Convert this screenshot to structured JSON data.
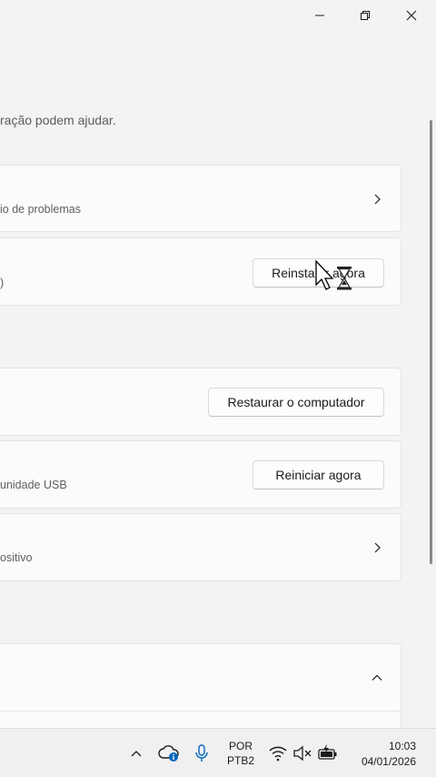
{
  "window": {
    "minimize_icon": "minimize-icon",
    "restore_icon": "restore-icon",
    "close_icon": "close-icon"
  },
  "intro_text": "ração podem ajudar.",
  "cards": {
    "troubleshoot": {
      "subtitle": "io de problemas"
    },
    "reinstall": {
      "subtitle": ")",
      "button": "Reinstalar agora"
    },
    "restore": {
      "button": "Restaurar o computador"
    },
    "advanced_startup": {
      "subtitle": "unidade USB",
      "button": "Reiniciar agora"
    },
    "device": {
      "subtitle": "ositivo"
    }
  },
  "taskbar": {
    "language_top": "POR",
    "language_bottom": "PTB2",
    "time": "10:03",
    "date": "04/01/2026"
  },
  "colors": {
    "accent": "#0067c0",
    "background": "#f3f3f3",
    "card": "#fbfbfb"
  }
}
